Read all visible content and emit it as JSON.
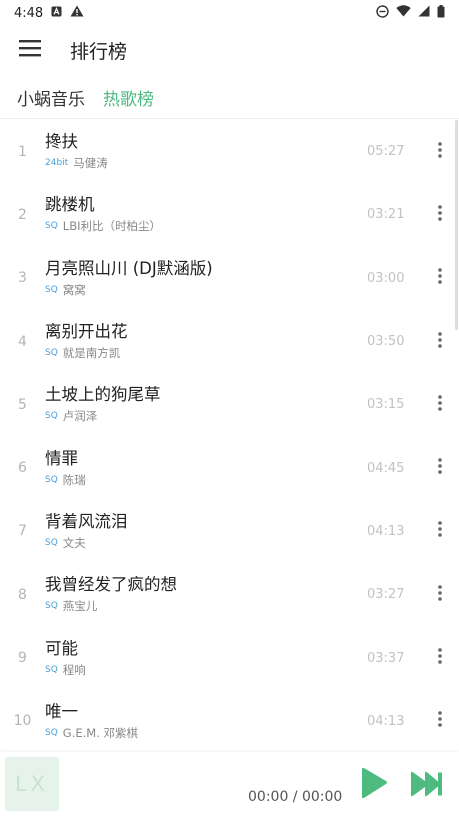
{
  "status_bar": {
    "time": "4:48"
  },
  "appbar": {
    "title": "排行榜"
  },
  "tabs": {
    "source": "小蜗音乐",
    "board": "热歌榜"
  },
  "songs": [
    {
      "rank": "1",
      "title": "搀扶",
      "quality": "24bit",
      "artist": "马健涛",
      "duration": "05:27"
    },
    {
      "rank": "2",
      "title": "跳楼机",
      "quality": "SQ",
      "artist": "LBI利比（时柏尘）",
      "duration": "03:21"
    },
    {
      "rank": "3",
      "title": "月亮照山川 (DJ默涵版)",
      "quality": "SQ",
      "artist": "窝窝",
      "duration": "03:00"
    },
    {
      "rank": "4",
      "title": "离别开出花",
      "quality": "SQ",
      "artist": "就是南方凯",
      "duration": "03:50"
    },
    {
      "rank": "5",
      "title": "土坡上的狗尾草",
      "quality": "SQ",
      "artist": "卢润泽",
      "duration": "03:15"
    },
    {
      "rank": "6",
      "title": "情罪",
      "quality": "SQ",
      "artist": "陈瑞",
      "duration": "04:45"
    },
    {
      "rank": "7",
      "title": "背着风流泪",
      "quality": "SQ",
      "artist": "文夫",
      "duration": "04:13"
    },
    {
      "rank": "8",
      "title": "我曾经发了疯的想",
      "quality": "SQ",
      "artist": "燕宝儿",
      "duration": "03:27"
    },
    {
      "rank": "9",
      "title": "可能",
      "quality": "SQ",
      "artist": "程响",
      "duration": "03:37"
    },
    {
      "rank": "10",
      "title": "唯一",
      "quality": "SQ",
      "artist": "G.E.M. 邓紫棋",
      "duration": "04:13"
    }
  ],
  "player": {
    "cover_text": "LX",
    "time": "00:00 / 00:00"
  },
  "colors": {
    "accent": "#4dbb7f",
    "quality": "#4a9fd9"
  },
  "icons": {
    "menu": "hamburger-menu-icon",
    "more": "more-vertical-icon",
    "play": "play-icon",
    "next": "skip-next-icon"
  }
}
